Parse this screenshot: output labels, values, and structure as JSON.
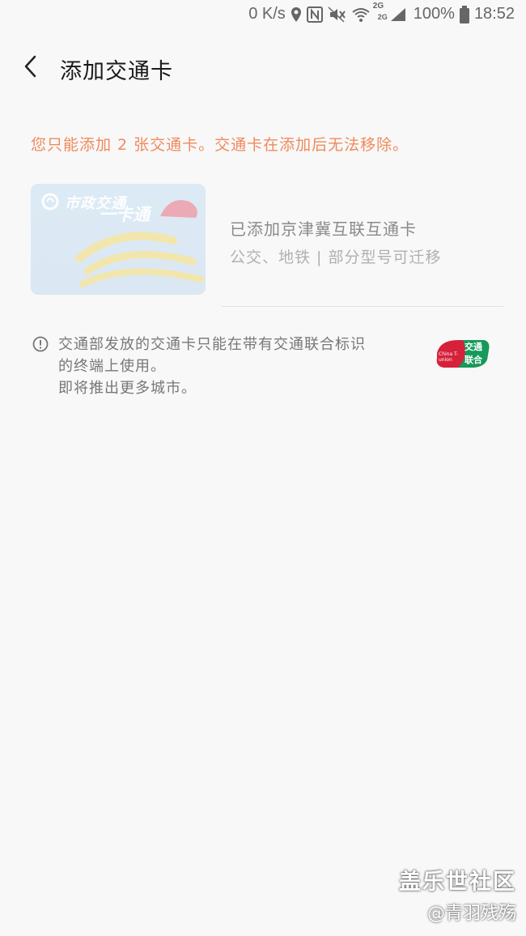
{
  "status_bar": {
    "speed": "0 K/s",
    "signal1_label": "2G",
    "signal2_label": "2G",
    "battery": "100%",
    "time": "18:52",
    "icons": [
      "location-icon",
      "nfc-icon",
      "mute-icon",
      "wifi-icon",
      "signal-icon",
      "battery-icon"
    ]
  },
  "header": {
    "title": "添加交通卡"
  },
  "warning": "您只能添加 2 张交通卡。交通卡在添加后无法移除。",
  "card": {
    "brand_text": "市政交通",
    "brand_text2": "一卡通",
    "title": "已添加京津冀互联互通卡",
    "subtitle": "公交、地铁 | 部分型号可迁移"
  },
  "info": {
    "line1": "交通部发放的交通卡只能在带有交通联合标识",
    "line2": "的终端上使用。",
    "line3": "即将推出更多城市。",
    "logo_text": "交通",
    "logo_text2": "联合",
    "logo_small": "China T-union"
  },
  "watermark": {
    "title": "盖乐世社区",
    "user": "@青羽残殇"
  },
  "colors": {
    "background": "#f8f8f8",
    "warning": "#f08a5d",
    "logo_red": "#d6213a",
    "logo_green": "#149a5a"
  }
}
